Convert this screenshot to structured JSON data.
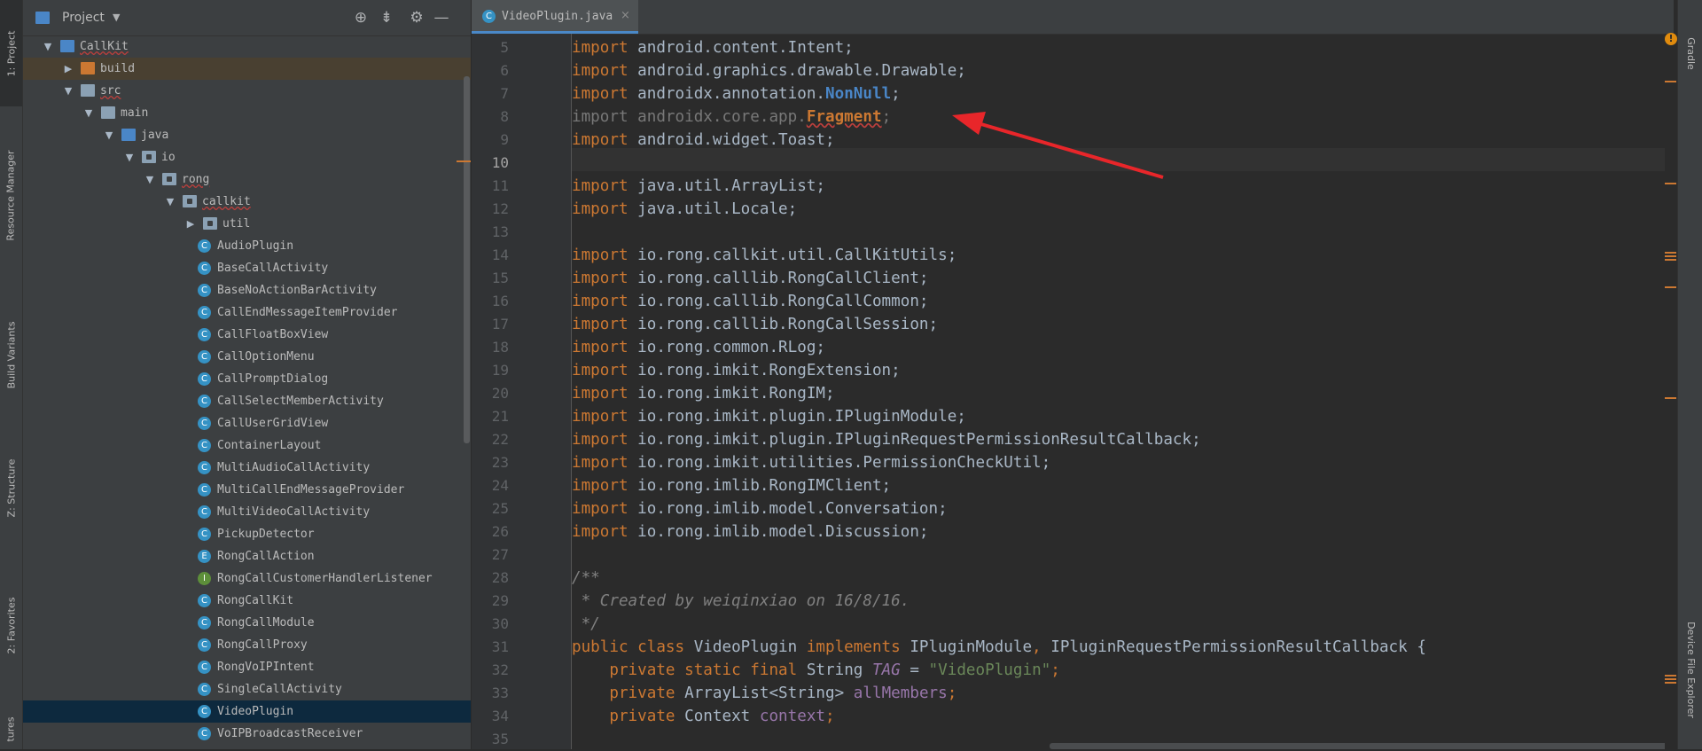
{
  "left_strip": {
    "tabs": [
      {
        "label": "1: Project",
        "icon": "project-icon"
      },
      {
        "label": "Resource Manager",
        "icon": "resource-manager-icon"
      },
      {
        "label": "Build Variants",
        "icon": "build-variants-icon"
      },
      {
        "label": "Z: Structure",
        "icon": "structure-icon"
      },
      {
        "label": "2: Favorites",
        "icon": "star-icon"
      },
      {
        "label": "tures",
        "icon": ""
      }
    ]
  },
  "project_panel": {
    "title": "Project",
    "header_icons": [
      "locate-icon",
      "collapse-icon",
      "gear-icon",
      "minimize-icon"
    ],
    "tree": [
      {
        "label": "CallKit",
        "type": "module",
        "depth": 0,
        "expanded": true
      },
      {
        "label": "build",
        "type": "folder-orange",
        "depth": 1,
        "expanded": false
      },
      {
        "label": "src",
        "type": "folder",
        "depth": 1,
        "expanded": true
      },
      {
        "label": "main",
        "type": "folder",
        "depth": 2,
        "expanded": true
      },
      {
        "label": "java",
        "type": "folder-blue",
        "depth": 3,
        "expanded": true
      },
      {
        "label": "io",
        "type": "package",
        "depth": 4,
        "expanded": true
      },
      {
        "label": "rong",
        "type": "package",
        "depth": 5,
        "expanded": true
      },
      {
        "label": "callkit",
        "type": "package",
        "depth": 6,
        "expanded": true
      },
      {
        "label": "util",
        "type": "package",
        "depth": 7,
        "expanded": false
      },
      {
        "label": "AudioPlugin",
        "type": "class",
        "depth": 7
      },
      {
        "label": "BaseCallActivity",
        "type": "class",
        "depth": 7
      },
      {
        "label": "BaseNoActionBarActivity",
        "type": "class",
        "depth": 7
      },
      {
        "label": "CallEndMessageItemProvider",
        "type": "class",
        "depth": 7
      },
      {
        "label": "CallFloatBoxView",
        "type": "class",
        "depth": 7
      },
      {
        "label": "CallOptionMenu",
        "type": "class",
        "depth": 7
      },
      {
        "label": "CallPromptDialog",
        "type": "class",
        "depth": 7
      },
      {
        "label": "CallSelectMemberActivity",
        "type": "class",
        "depth": 7
      },
      {
        "label": "CallUserGridView",
        "type": "class",
        "depth": 7
      },
      {
        "label": "ContainerLayout",
        "type": "class",
        "depth": 7
      },
      {
        "label": "MultiAudioCallActivity",
        "type": "class",
        "depth": 7
      },
      {
        "label": "MultiCallEndMessageProvider",
        "type": "class",
        "depth": 7
      },
      {
        "label": "MultiVideoCallActivity",
        "type": "class",
        "depth": 7
      },
      {
        "label": "PickupDetector",
        "type": "class",
        "depth": 7
      },
      {
        "label": "RongCallAction",
        "type": "enum",
        "depth": 7
      },
      {
        "label": "RongCallCustomerHandlerListener",
        "type": "interface",
        "depth": 7
      },
      {
        "label": "RongCallKit",
        "type": "class",
        "depth": 7
      },
      {
        "label": "RongCallModule",
        "type": "class",
        "depth": 7
      },
      {
        "label": "RongCallProxy",
        "type": "class",
        "depth": 7
      },
      {
        "label": "RongVoIPIntent",
        "type": "class",
        "depth": 7
      },
      {
        "label": "SingleCallActivity",
        "type": "class",
        "depth": 7
      },
      {
        "label": "VideoPlugin",
        "type": "class",
        "depth": 7,
        "selected": true
      },
      {
        "label": "VoIPBroadcastReceiver",
        "type": "class",
        "depth": 7
      }
    ]
  },
  "editor": {
    "tab": {
      "label": "VideoPlugin.java",
      "close": "×"
    },
    "current_line": 10,
    "lines": [
      {
        "n": 5,
        "tokens": [
          [
            "kw",
            "import"
          ],
          [
            "t",
            " android.content.Intent;"
          ]
        ]
      },
      {
        "n": 6,
        "tokens": [
          [
            "kw",
            "import"
          ],
          [
            "t",
            " android.graphics.drawable.Drawable;"
          ]
        ]
      },
      {
        "n": 7,
        "tokens": [
          [
            "kw",
            "import"
          ],
          [
            "t",
            " androidx.annotation."
          ],
          [
            "bold-blue",
            "NonNull"
          ],
          [
            "t",
            ";"
          ]
        ]
      },
      {
        "n": 8,
        "tokens": [
          [
            "unused",
            "import androidx.core.app."
          ],
          [
            "err",
            "Fragment"
          ],
          [
            "unused",
            ";"
          ]
        ]
      },
      {
        "n": 9,
        "tokens": [
          [
            "kw",
            "import"
          ],
          [
            "t",
            " android.widget.Toast;"
          ]
        ]
      },
      {
        "n": 10,
        "tokens": []
      },
      {
        "n": 11,
        "tokens": [
          [
            "kw",
            "import"
          ],
          [
            "t",
            " java.util.ArrayList;"
          ]
        ]
      },
      {
        "n": 12,
        "tokens": [
          [
            "kw",
            "import"
          ],
          [
            "t",
            " java.util.Locale;"
          ]
        ]
      },
      {
        "n": 13,
        "tokens": []
      },
      {
        "n": 14,
        "tokens": [
          [
            "kw",
            "import"
          ],
          [
            "t",
            " io.rong.callkit.util.CallKitUtils;"
          ]
        ]
      },
      {
        "n": 15,
        "tokens": [
          [
            "kw",
            "import"
          ],
          [
            "t",
            " io.rong.calllib.RongCallClient;"
          ]
        ]
      },
      {
        "n": 16,
        "tokens": [
          [
            "kw",
            "import"
          ],
          [
            "t",
            " io.rong.calllib.RongCallCommon;"
          ]
        ]
      },
      {
        "n": 17,
        "tokens": [
          [
            "kw",
            "import"
          ],
          [
            "t",
            " io.rong.calllib.RongCallSession;"
          ]
        ]
      },
      {
        "n": 18,
        "tokens": [
          [
            "kw",
            "import"
          ],
          [
            "t",
            " io.rong.common.RLog;"
          ]
        ]
      },
      {
        "n": 19,
        "tokens": [
          [
            "kw",
            "import"
          ],
          [
            "t",
            " io.rong.imkit.RongExtension;"
          ]
        ]
      },
      {
        "n": 20,
        "tokens": [
          [
            "kw",
            "import"
          ],
          [
            "t",
            " io.rong.imkit.RongIM;"
          ]
        ]
      },
      {
        "n": 21,
        "tokens": [
          [
            "kw",
            "import"
          ],
          [
            "t",
            " io.rong.imkit.plugin.IPluginModule;"
          ]
        ]
      },
      {
        "n": 22,
        "tokens": [
          [
            "kw",
            "import"
          ],
          [
            "t",
            " io.rong.imkit.plugin.IPluginRequestPermissionResultCallback;"
          ]
        ]
      },
      {
        "n": 23,
        "tokens": [
          [
            "kw",
            "import"
          ],
          [
            "t",
            " io.rong.imkit.utilities.PermissionCheckUtil;"
          ]
        ]
      },
      {
        "n": 24,
        "tokens": [
          [
            "kw",
            "import"
          ],
          [
            "t",
            " io.rong.imlib.RongIMClient;"
          ]
        ]
      },
      {
        "n": 25,
        "tokens": [
          [
            "kw",
            "import"
          ],
          [
            "t",
            " io.rong.imlib.model.Conversation;"
          ]
        ]
      },
      {
        "n": 26,
        "tokens": [
          [
            "kw",
            "import"
          ],
          [
            "t",
            " io.rong.imlib.model.Discussion;"
          ]
        ]
      },
      {
        "n": 27,
        "tokens": []
      },
      {
        "n": 28,
        "tokens": [
          [
            "cmt",
            "/**"
          ]
        ]
      },
      {
        "n": 29,
        "tokens": [
          [
            "cmt",
            " * Created by weiqinxiao on 16/8/16."
          ]
        ]
      },
      {
        "n": 30,
        "tokens": [
          [
            "cmt",
            " */"
          ]
        ]
      },
      {
        "n": 31,
        "tokens": [
          [
            "kw",
            "public class"
          ],
          [
            "t",
            " VideoPlugin "
          ],
          [
            "kw",
            "implements"
          ],
          [
            "t",
            " IPluginModule"
          ],
          [
            "kw",
            ","
          ],
          [
            "t",
            " IPluginRequestPermissionResultCallback {"
          ]
        ]
      },
      {
        "n": 32,
        "tokens": [
          [
            "t",
            "    "
          ],
          [
            "kw",
            "private static final"
          ],
          [
            "t",
            " String "
          ],
          [
            "cst",
            "TAG"
          ],
          [
            "t",
            " = "
          ],
          [
            "str",
            "\"VideoPlugin\""
          ],
          [
            "kw",
            ";"
          ]
        ]
      },
      {
        "n": 33,
        "tokens": [
          [
            "t",
            "    "
          ],
          [
            "kw",
            "private"
          ],
          [
            "t",
            " ArrayList<String> "
          ],
          [
            "fld",
            "allMembers"
          ],
          [
            "kw",
            ";"
          ]
        ]
      },
      {
        "n": 34,
        "tokens": [
          [
            "t",
            "    "
          ],
          [
            "kw",
            "private"
          ],
          [
            "t",
            " Context "
          ],
          [
            "fld",
            "context"
          ],
          [
            "kw",
            ";"
          ]
        ]
      },
      {
        "n": 35,
        "tokens": []
      }
    ]
  },
  "right_strip": {
    "tabs": [
      {
        "label": "Gradle",
        "icon": "gradle-icon"
      },
      {
        "label": "Device File Explorer",
        "icon": "device-icon"
      }
    ],
    "warning_icon": "warning-icon"
  },
  "colors": {
    "background": "#2b2b2b",
    "panel": "#3c3f41",
    "keyword": "#cc7832",
    "selection": "#0d293e",
    "annotation_arrow": "#e8262a"
  }
}
